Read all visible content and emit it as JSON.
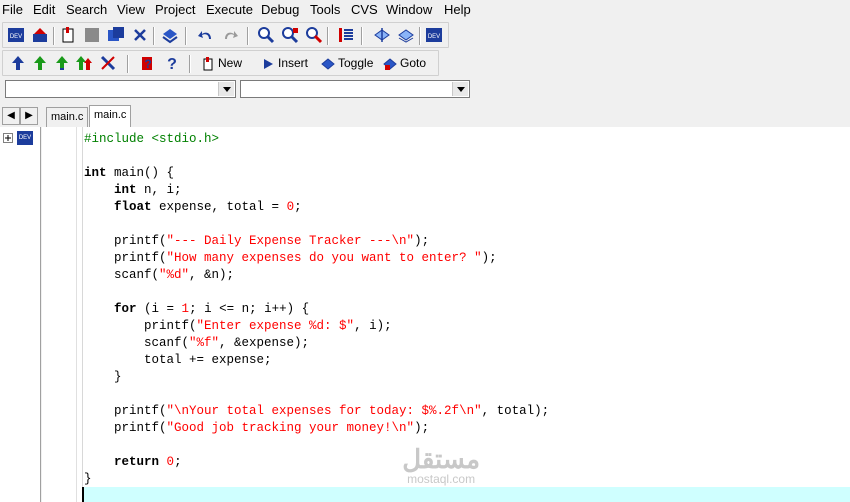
{
  "menu": [
    "File",
    "Edit",
    "Search",
    "View",
    "Project",
    "Execute",
    "Debug",
    "Tools",
    "CVS",
    "Window",
    "Help"
  ],
  "toolbar2": {
    "new_label": "New",
    "insert_label": "Insert",
    "toggle_label": "Toggle",
    "goto_label": "Goto"
  },
  "tabs": [
    "main.c",
    "main.c"
  ],
  "tree": {
    "project_label": "DEV"
  },
  "code_lines": [
    [
      {
        "t": "#include <stdio.h>",
        "c": "pp"
      }
    ],
    [],
    [
      {
        "t": "int",
        "c": "kw"
      },
      {
        "t": " main() {",
        "c": ""
      }
    ],
    [
      {
        "t": "    ",
        "c": ""
      },
      {
        "t": "int",
        "c": "kw"
      },
      {
        "t": " n, i;",
        "c": ""
      }
    ],
    [
      {
        "t": "    ",
        "c": ""
      },
      {
        "t": "float",
        "c": "kw"
      },
      {
        "t": " expense, total = ",
        "c": ""
      },
      {
        "t": "0",
        "c": "num"
      },
      {
        "t": ";",
        "c": ""
      }
    ],
    [],
    [
      {
        "t": "    printf(",
        "c": ""
      },
      {
        "t": "\"--- Daily Expense Tracker ---\\n\"",
        "c": "str"
      },
      {
        "t": ");",
        "c": ""
      }
    ],
    [
      {
        "t": "    printf(",
        "c": ""
      },
      {
        "t": "\"How many expenses do you want to enter? \"",
        "c": "str"
      },
      {
        "t": ");",
        "c": ""
      }
    ],
    [
      {
        "t": "    scanf(",
        "c": ""
      },
      {
        "t": "\"%d\"",
        "c": "str"
      },
      {
        "t": ", &n);",
        "c": ""
      }
    ],
    [],
    [
      {
        "t": "    ",
        "c": ""
      },
      {
        "t": "for",
        "c": "kw"
      },
      {
        "t": " (i = ",
        "c": ""
      },
      {
        "t": "1",
        "c": "num"
      },
      {
        "t": "; i <= n; i++) {",
        "c": ""
      }
    ],
    [
      {
        "t": "        printf(",
        "c": ""
      },
      {
        "t": "\"Enter expense %d: $\"",
        "c": "str"
      },
      {
        "t": ", i);",
        "c": ""
      }
    ],
    [
      {
        "t": "        scanf(",
        "c": ""
      },
      {
        "t": "\"%f\"",
        "c": "str"
      },
      {
        "t": ", &expense);",
        "c": ""
      }
    ],
    [
      {
        "t": "        total += expense;",
        "c": ""
      }
    ],
    [
      {
        "t": "    }",
        "c": ""
      }
    ],
    [],
    [
      {
        "t": "    printf(",
        "c": ""
      },
      {
        "t": "\"\\nYour total expenses for today: $%.2f\\n\"",
        "c": "str"
      },
      {
        "t": ", total);",
        "c": ""
      }
    ],
    [
      {
        "t": "    printf(",
        "c": ""
      },
      {
        "t": "\"Good job tracking your money!\\n\"",
        "c": "str"
      },
      {
        "t": ");",
        "c": ""
      }
    ],
    [],
    [
      {
        "t": "    ",
        "c": ""
      },
      {
        "t": "return",
        "c": "kw"
      },
      {
        "t": " ",
        "c": ""
      },
      {
        "t": "0",
        "c": "num"
      },
      {
        "t": ";",
        "c": ""
      }
    ],
    [
      {
        "t": "}",
        "c": ""
      }
    ]
  ],
  "watermark": {
    "arabic": "مستقل",
    "latin": "mostaql.com"
  },
  "colors": {
    "string": "#ff0000",
    "preprocessor": "#008000",
    "current_line": "#cfffff"
  }
}
